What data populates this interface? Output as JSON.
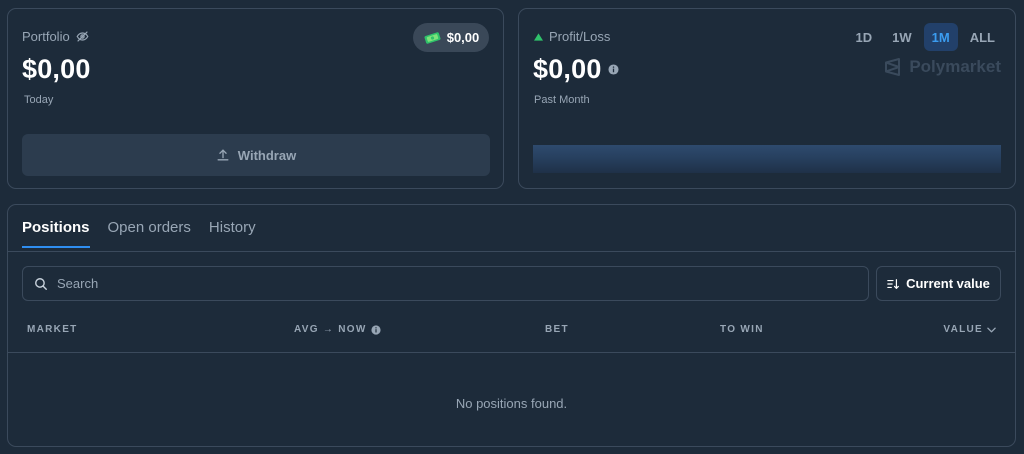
{
  "portfolio": {
    "title": "Portfolio",
    "value": "$0,00",
    "period": "Today",
    "cash_balance": "$0,00",
    "withdraw_label": "Withdraw"
  },
  "pnl": {
    "title": "Profit/Loss",
    "value": "$0,00",
    "period": "Past Month",
    "ranges": [
      "1D",
      "1W",
      "1M",
      "ALL"
    ],
    "active_range": "1M",
    "watermark": "Polymarket"
  },
  "positions": {
    "tabs": [
      "Positions",
      "Open orders",
      "History"
    ],
    "active_tab": "Positions",
    "search_placeholder": "Search",
    "sort_label": "Current value",
    "columns": {
      "market": "MARKET",
      "avg_now": "AVG → NOW",
      "bet": "BET",
      "to_win": "TO WIN",
      "value": "VALUE"
    },
    "empty_message": "No positions found."
  },
  "colors": {
    "background": "#1d2b3a",
    "border": "#3b4a5c",
    "accent": "#2f8ef0",
    "positive": "#2fc26b",
    "muted_text": "#98a6b5"
  }
}
